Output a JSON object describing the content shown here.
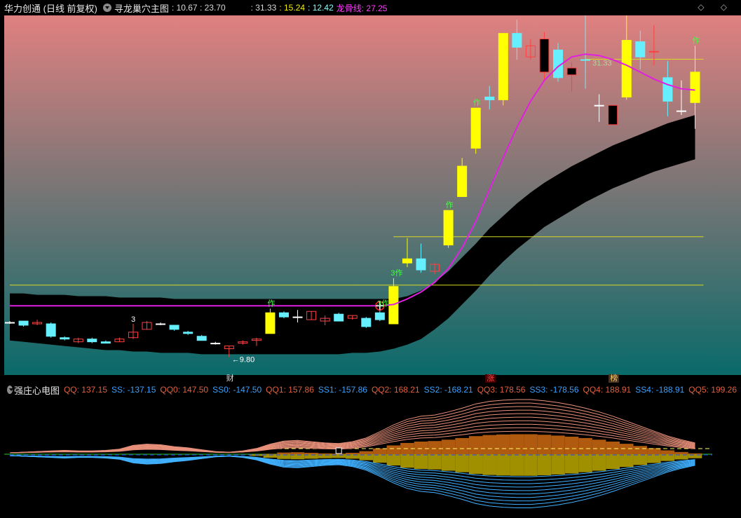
{
  "header": {
    "stock_name": "华力创通 (日线 前复权)",
    "indicator_name": "寻龙巢穴主图",
    "values_a": ": 10.67 : 23.70",
    "values_b": ": 31.33",
    "values_c": ": 15.24",
    "values_d": ": 12.42",
    "dragon_label": "龙骨线: 27.25",
    "window_controls": "◇ ◇"
  },
  "colors": {
    "bg_top": "#e08080",
    "bg_bottom": "#0a6a6a",
    "candle_up": "#ffff00",
    "candle_down_cyan": "#66f0ff",
    "dragon_line": "#e020e0",
    "band": "#000000",
    "hline": "#d8d820"
  },
  "chart_data": {
    "type": "candlestick",
    "price_range": [
      8.5,
      34.5
    ],
    "max_label": "31.33",
    "min_label": "9.80",
    "hlines": [
      18.5,
      15.0
    ],
    "hline_top": 31.33,
    "candles": [
      {
        "o": 12.3,
        "c": 12.3,
        "h": 12.4,
        "l": 12.2,
        "s": "cross"
      },
      {
        "o": 12.1,
        "c": 12.4,
        "h": 12.4,
        "l": 12.0,
        "s": "cyan"
      },
      {
        "o": 12.2,
        "c": 12.3,
        "h": 12.5,
        "l": 12.1,
        "s": "red"
      },
      {
        "o": 12.2,
        "c": 11.3,
        "h": 12.3,
        "l": 11.2,
        "s": "cyan"
      },
      {
        "o": 11.1,
        "c": 11.2,
        "h": 11.3,
        "l": 11.0,
        "s": "cyan"
      },
      {
        "o": 10.9,
        "c": 11.1,
        "h": 11.2,
        "l": 10.8,
        "s": "red"
      },
      {
        "o": 11.1,
        "c": 10.9,
        "h": 11.2,
        "l": 10.8,
        "s": "cyan"
      },
      {
        "o": 10.9,
        "c": 10.8,
        "h": 11.0,
        "l": 10.8,
        "s": "cyan"
      },
      {
        "o": 10.9,
        "c": 11.1,
        "h": 11.2,
        "l": 10.9,
        "s": "red"
      },
      {
        "o": 11.2,
        "c": 11.6,
        "h": 12.2,
        "l": 11.1,
        "s": "red"
      },
      {
        "o": 11.8,
        "c": 12.3,
        "h": 12.4,
        "l": 11.8,
        "s": "red"
      },
      {
        "o": 12.2,
        "c": 12.2,
        "h": 12.3,
        "l": 12.1,
        "s": "cross"
      },
      {
        "o": 12.1,
        "c": 11.8,
        "h": 12.1,
        "l": 11.7,
        "s": "cyan"
      },
      {
        "o": 11.6,
        "c": 11.5,
        "h": 11.7,
        "l": 11.4,
        "s": "cyan"
      },
      {
        "o": 11.3,
        "c": 11.0,
        "h": 11.4,
        "l": 11.0,
        "s": "cyan"
      },
      {
        "o": 10.8,
        "c": 10.8,
        "h": 10.9,
        "l": 10.7,
        "s": "cross"
      },
      {
        "o": 10.4,
        "c": 10.6,
        "h": 10.6,
        "l": 9.8,
        "s": "red"
      },
      {
        "o": 10.8,
        "c": 10.9,
        "h": 11.0,
        "l": 10.7,
        "s": "red"
      },
      {
        "o": 11.0,
        "c": 11.1,
        "h": 11.2,
        "l": 10.6,
        "s": "red"
      },
      {
        "o": 11.5,
        "c": 13.0,
        "h": 13.3,
        "l": 11.5,
        "s": "yellow"
      },
      {
        "o": 13.0,
        "c": 12.7,
        "h": 13.1,
        "l": 12.6,
        "s": "cyan"
      },
      {
        "o": 12.7,
        "c": 12.7,
        "h": 13.2,
        "l": 12.3,
        "s": "cross"
      },
      {
        "o": 12.5,
        "c": 13.1,
        "h": 13.1,
        "l": 12.5,
        "s": "red"
      },
      {
        "o": 12.4,
        "c": 12.6,
        "h": 12.8,
        "l": 12.1,
        "s": "red"
      },
      {
        "o": 12.9,
        "c": 12.4,
        "h": 13.0,
        "l": 12.4,
        "s": "cyan"
      },
      {
        "o": 12.6,
        "c": 12.8,
        "h": 12.8,
        "l": 12.5,
        "s": "red"
      },
      {
        "o": 12.6,
        "c": 12.0,
        "h": 12.7,
        "l": 11.9,
        "s": "cyan"
      },
      {
        "o": 12.5,
        "c": 13.0,
        "h": 13.3,
        "l": 12.4,
        "s": "cyan"
      },
      {
        "o": 12.2,
        "c": 14.9,
        "h": 15.5,
        "l": 12.2,
        "s": "yellow"
      },
      {
        "o": 16.6,
        "c": 16.9,
        "h": 18.4,
        "l": 16.3,
        "s": "yellow"
      },
      {
        "o": 16.9,
        "c": 16.1,
        "h": 18.0,
        "l": 15.9,
        "s": "cyan"
      },
      {
        "o": 16.5,
        "c": 16.0,
        "h": 16.6,
        "l": 15.8,
        "s": "red"
      },
      {
        "o": 17.9,
        "c": 20.4,
        "h": 20.4,
        "l": 17.7,
        "s": "yellow"
      },
      {
        "o": 21.4,
        "c": 23.6,
        "h": 24.2,
        "l": 21.4,
        "s": "yellow"
      },
      {
        "o": 24.9,
        "c": 27.8,
        "h": 27.8,
        "l": 24.5,
        "s": "yellow"
      },
      {
        "o": 28.4,
        "c": 28.6,
        "h": 29.4,
        "l": 27.7,
        "s": "cyan"
      },
      {
        "o": 28.4,
        "c": 33.2,
        "h": 33.2,
        "l": 28.0,
        "s": "yellow"
      },
      {
        "o": 33.2,
        "c": 32.2,
        "h": 34.2,
        "l": 31.3,
        "s": "cyan"
      },
      {
        "o": 32.3,
        "c": 31.5,
        "h": 32.8,
        "l": 31.3,
        "s": "red"
      },
      {
        "o": 32.8,
        "c": 30.4,
        "h": 33.3,
        "l": 29.8,
        "s": "black"
      },
      {
        "o": 32.0,
        "c": 30.0,
        "h": 32.5,
        "l": 29.7,
        "s": "cyan"
      },
      {
        "o": 30.2,
        "c": 30.7,
        "h": 31.1,
        "l": 29.0,
        "s": "black"
      },
      {
        "o": 31.3,
        "c": 31.3,
        "h": 35.0,
        "l": 29.2,
        "s": "cyan"
      },
      {
        "o": 28.0,
        "c": 28.0,
        "h": 28.8,
        "l": 26.8,
        "s": "cross"
      },
      {
        "o": 26.6,
        "c": 28.0,
        "h": 28.0,
        "l": 26.6,
        "s": "black"
      },
      {
        "o": 28.6,
        "c": 32.7,
        "h": 35.6,
        "l": 28.4,
        "s": "yellow"
      },
      {
        "o": 32.6,
        "c": 31.5,
        "h": 33.4,
        "l": 30.6,
        "s": "cyan"
      },
      {
        "o": 31.9,
        "c": 31.9,
        "h": 33.8,
        "l": 30.9,
        "s": "red"
      },
      {
        "o": 30.0,
        "c": 28.3,
        "h": 31.2,
        "l": 27.2,
        "s": "cyan"
      },
      {
        "o": 27.6,
        "c": 27.6,
        "h": 29.8,
        "l": 27.3,
        "s": "cross"
      },
      {
        "o": 28.2,
        "c": 30.4,
        "h": 32.3,
        "l": 26.3,
        "s": "yellow"
      }
    ],
    "dragon": [
      13.5,
      13.5,
      13.5,
      13.5,
      13.5,
      13.5,
      13.5,
      13.5,
      13.5,
      13.5,
      13.5,
      13.5,
      13.5,
      13.5,
      13.5,
      13.5,
      13.5,
      13.5,
      13.5,
      13.5,
      13.5,
      13.5,
      13.5,
      13.5,
      13.5,
      13.5,
      13.5,
      13.5,
      13.6,
      14.0,
      14.5,
      15.2,
      16.2,
      17.7,
      19.6,
      21.9,
      24.2,
      26.4,
      28.3,
      29.8,
      30.8,
      31.5,
      31.7,
      31.6,
      31.3,
      30.9,
      30.4,
      29.9,
      29.5,
      29.2,
      29.1
    ],
    "band_upper": [
      14.4,
      14.4,
      14.3,
      14.3,
      14.3,
      14.2,
      14.2,
      14.2,
      14.1,
      14.1,
      14.1,
      14.1,
      14.0,
      14.0,
      14.0,
      14.0,
      14.0,
      14.0,
      14.0,
      14.0,
      14.0,
      14.0,
      14.0,
      14.0,
      14.0,
      14.0,
      14.0,
      14.0,
      14.0,
      14.2,
      14.6,
      15.2,
      16.0,
      17.0,
      18.0,
      19.1,
      20.0,
      20.9,
      21.7,
      22.4,
      23.0,
      23.6,
      24.1,
      24.6,
      25.1,
      25.5,
      25.9,
      26.3,
      26.7,
      27.0,
      27.3
    ],
    "band_lower": [
      11.0,
      10.9,
      10.8,
      10.7,
      10.6,
      10.5,
      10.4,
      10.3,
      10.3,
      10.2,
      10.2,
      10.1,
      10.1,
      10.1,
      10.0,
      10.0,
      10.0,
      10.0,
      10.0,
      10.0,
      10.0,
      10.0,
      10.0,
      10.0,
      10.0,
      10.1,
      10.1,
      10.2,
      10.4,
      10.7,
      11.1,
      11.8,
      12.6,
      13.6,
      14.6,
      15.7,
      16.7,
      17.6,
      18.4,
      19.2,
      19.8,
      20.4,
      21.0,
      21.5,
      22.0,
      22.4,
      22.8,
      23.2,
      23.5,
      23.8,
      24.1
    ],
    "signals": [
      {
        "i": 19,
        "text": "作"
      },
      {
        "i": 27,
        "text": "3作"
      },
      {
        "i": 28,
        "text": "3作"
      },
      {
        "i": 32,
        "text": "作"
      },
      {
        "i": 34,
        "text": "作"
      },
      {
        "i": 42,
        "text": "作"
      },
      {
        "i": 45,
        "text": "作"
      },
      {
        "i": 50,
        "text": "作"
      }
    ],
    "marks": [
      {
        "i": 16,
        "text": "财",
        "color": "#dddddd"
      },
      {
        "i": 35,
        "text": "涨",
        "color": "#ff4040"
      },
      {
        "i": 44,
        "text": "榜",
        "color": "#ffcc66"
      }
    ],
    "small_labels": [
      {
        "i": 9,
        "text": "3"
      }
    ],
    "sub_indicator": {
      "title": "强庄心电图",
      "values": [
        {
          "k": "QQ",
          "v": "137.15",
          "color": "#e06040"
        },
        {
          "k": "SS",
          "v": "-137.15",
          "color": "#3aa0ff"
        },
        {
          "k": "QQ0",
          "v": "147.50",
          "color": "#e06040"
        },
        {
          "k": "SS0",
          "v": "-147.50",
          "color": "#3aa0ff"
        },
        {
          "k": "QQ1",
          "v": "157.86",
          "color": "#e06040"
        },
        {
          "k": "SS1",
          "v": "-157.86",
          "color": "#3aa0ff"
        },
        {
          "k": "QQ2",
          "v": "168.21",
          "color": "#e06040"
        },
        {
          "k": "SS2",
          "v": "-168.21",
          "color": "#3aa0ff"
        },
        {
          "k": "QQ3",
          "v": "178.56",
          "color": "#e06040"
        },
        {
          "k": "SS3",
          "v": "-178.56",
          "color": "#3aa0ff"
        },
        {
          "k": "QQ4",
          "v": "188.91",
          "color": "#e06040"
        },
        {
          "k": "SS4",
          "v": "-188.91",
          "color": "#3aa0ff"
        },
        {
          "k": "QQ5",
          "v": "199.26",
          "color": "#e06040"
        }
      ],
      "energy": [
        0,
        0.1,
        0.2,
        0.3,
        0.4,
        0.3,
        0.3,
        0.4,
        0.6,
        1.2,
        1.4,
        1.3,
        1.0,
        0.8,
        0.5,
        0.2,
        0.1,
        0.3,
        0.7,
        1.4,
        1.9,
        2.0,
        1.8,
        1.6,
        1.5,
        1.8,
        2.4,
        3.4,
        4.5,
        5.4,
        5.9,
        6.1,
        6.6,
        7.2,
        7.9,
        8.3,
        8.5,
        8.6,
        8.6,
        8.4,
        8.1,
        7.7,
        7.2,
        6.6,
        5.9,
        5.1,
        4.3,
        3.5,
        2.7,
        2.1,
        1.6
      ]
    }
  }
}
